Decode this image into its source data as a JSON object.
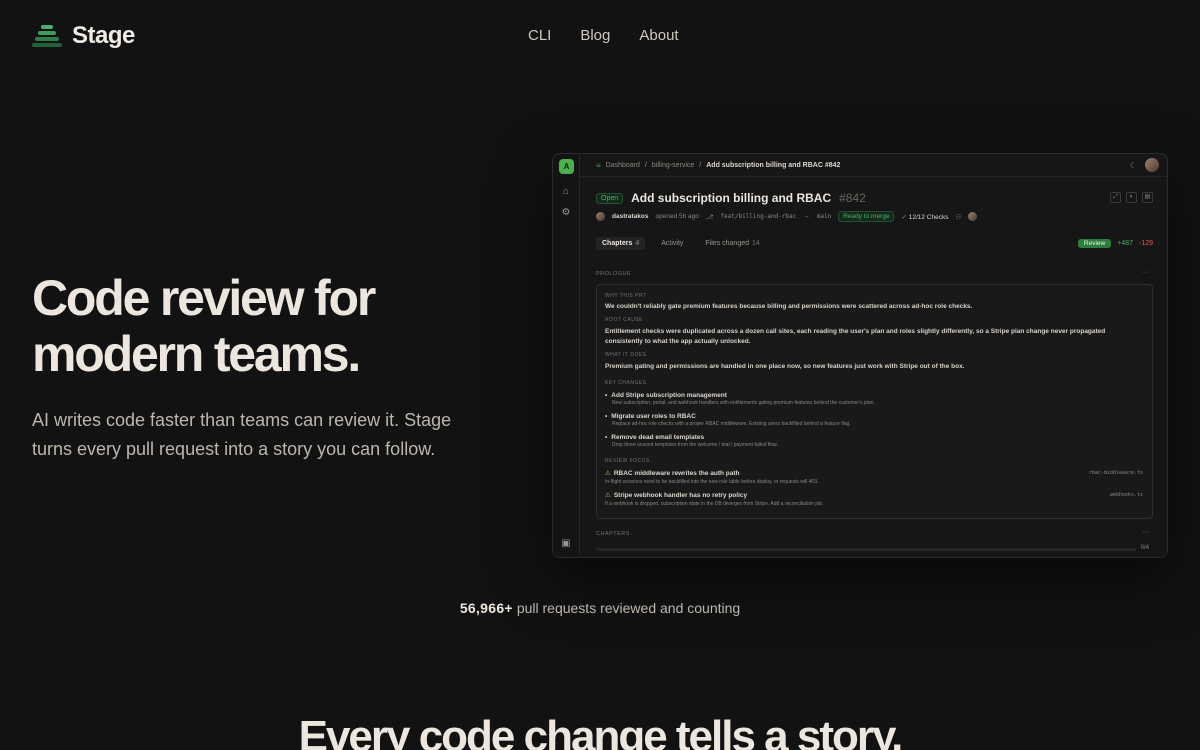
{
  "nav": {
    "brand": "Stage",
    "links": [
      "CLI",
      "Blog",
      "About"
    ]
  },
  "hero": {
    "title": "Code review for modern teams.",
    "subtitle": "AI writes code faster than teams can review it. Stage turns every pull request into a story you can follow."
  },
  "app": {
    "rail_avatar": "A",
    "breadcrumb": [
      "Dashboard",
      "billing-service",
      "Add subscription billing and RBAC #842"
    ],
    "pr": {
      "status": "Open",
      "title": "Add subscription billing and RBAC",
      "number": "#842",
      "author": "dastratakos",
      "opened": "opened 5h ago",
      "branch": "feat/billing-and-rbac",
      "arrow": "→",
      "base": "main",
      "merge_status": "Ready to merge",
      "checks": "12/12 Checks"
    },
    "tabs": [
      {
        "label": "Chapters",
        "count": "4"
      },
      {
        "label": "Activity",
        "count": ""
      },
      {
        "label": "Files changed",
        "count": "14"
      }
    ],
    "review_label": "Review",
    "additions": "+487",
    "deletions": "-129",
    "prologue_label": "PROLOGUE",
    "why_label": "WHY THIS PR?",
    "why_text": "We couldn't reliably gate premium features because billing and permissions were scattered across ad-hoc role checks.",
    "root_label": "ROOT CAUSE",
    "root_text": "Entitlement checks were duplicated across a dozen call sites, each reading the user's plan and roles slightly differently, so a Stripe plan change never propagated consistently to what the app actually unlocked.",
    "what_label": "WHAT IT DOES",
    "what_text": "Premium gating and permissions are handled in one place now, so new features just work with Stripe out of the box.",
    "key_label": "KEY CHANGES",
    "key_changes": [
      {
        "title": "Add Stripe subscription management",
        "desc": "New subscription, portal, and webhook handlers with entitlements gating premium features behind the customer's plan."
      },
      {
        "title": "Migrate user roles to RBAC",
        "desc": "Replace ad-hoc role checks with a proper RBAC middleware. Existing users backfilled behind a feature flag."
      },
      {
        "title": "Remove dead email templates",
        "desc": "Drop three unused templates from the welcome / trial / payment-failed flow."
      }
    ],
    "focus_label": "REVIEW FOCUS",
    "review_focus": [
      {
        "title": "RBAC middleware rewrites the auth path",
        "desc": "In-flight sessions need to be backfilled into the new role table before deploy, or requests will 403.",
        "file": "rbac-middleware.ts"
      },
      {
        "title": "Stripe webhook handler has no retry policy",
        "desc": "If a webhook is dropped, subscription state in the DB diverges from Stripe. Add a reconciliation job.",
        "file": "webhooks.ts"
      }
    ],
    "chapters_label": "CHAPTERS",
    "progress": "0/4",
    "progress_fraction": 0
  },
  "stats": {
    "count": "56,966+",
    "suffix": "pull requests reviewed and counting"
  },
  "section": {
    "title": "Every code change tells a story."
  },
  "colors": {
    "background": "#121212",
    "accent_green": "#4caf6a",
    "deletions_red": "#e05a4f",
    "warning": "#e0a43a"
  }
}
